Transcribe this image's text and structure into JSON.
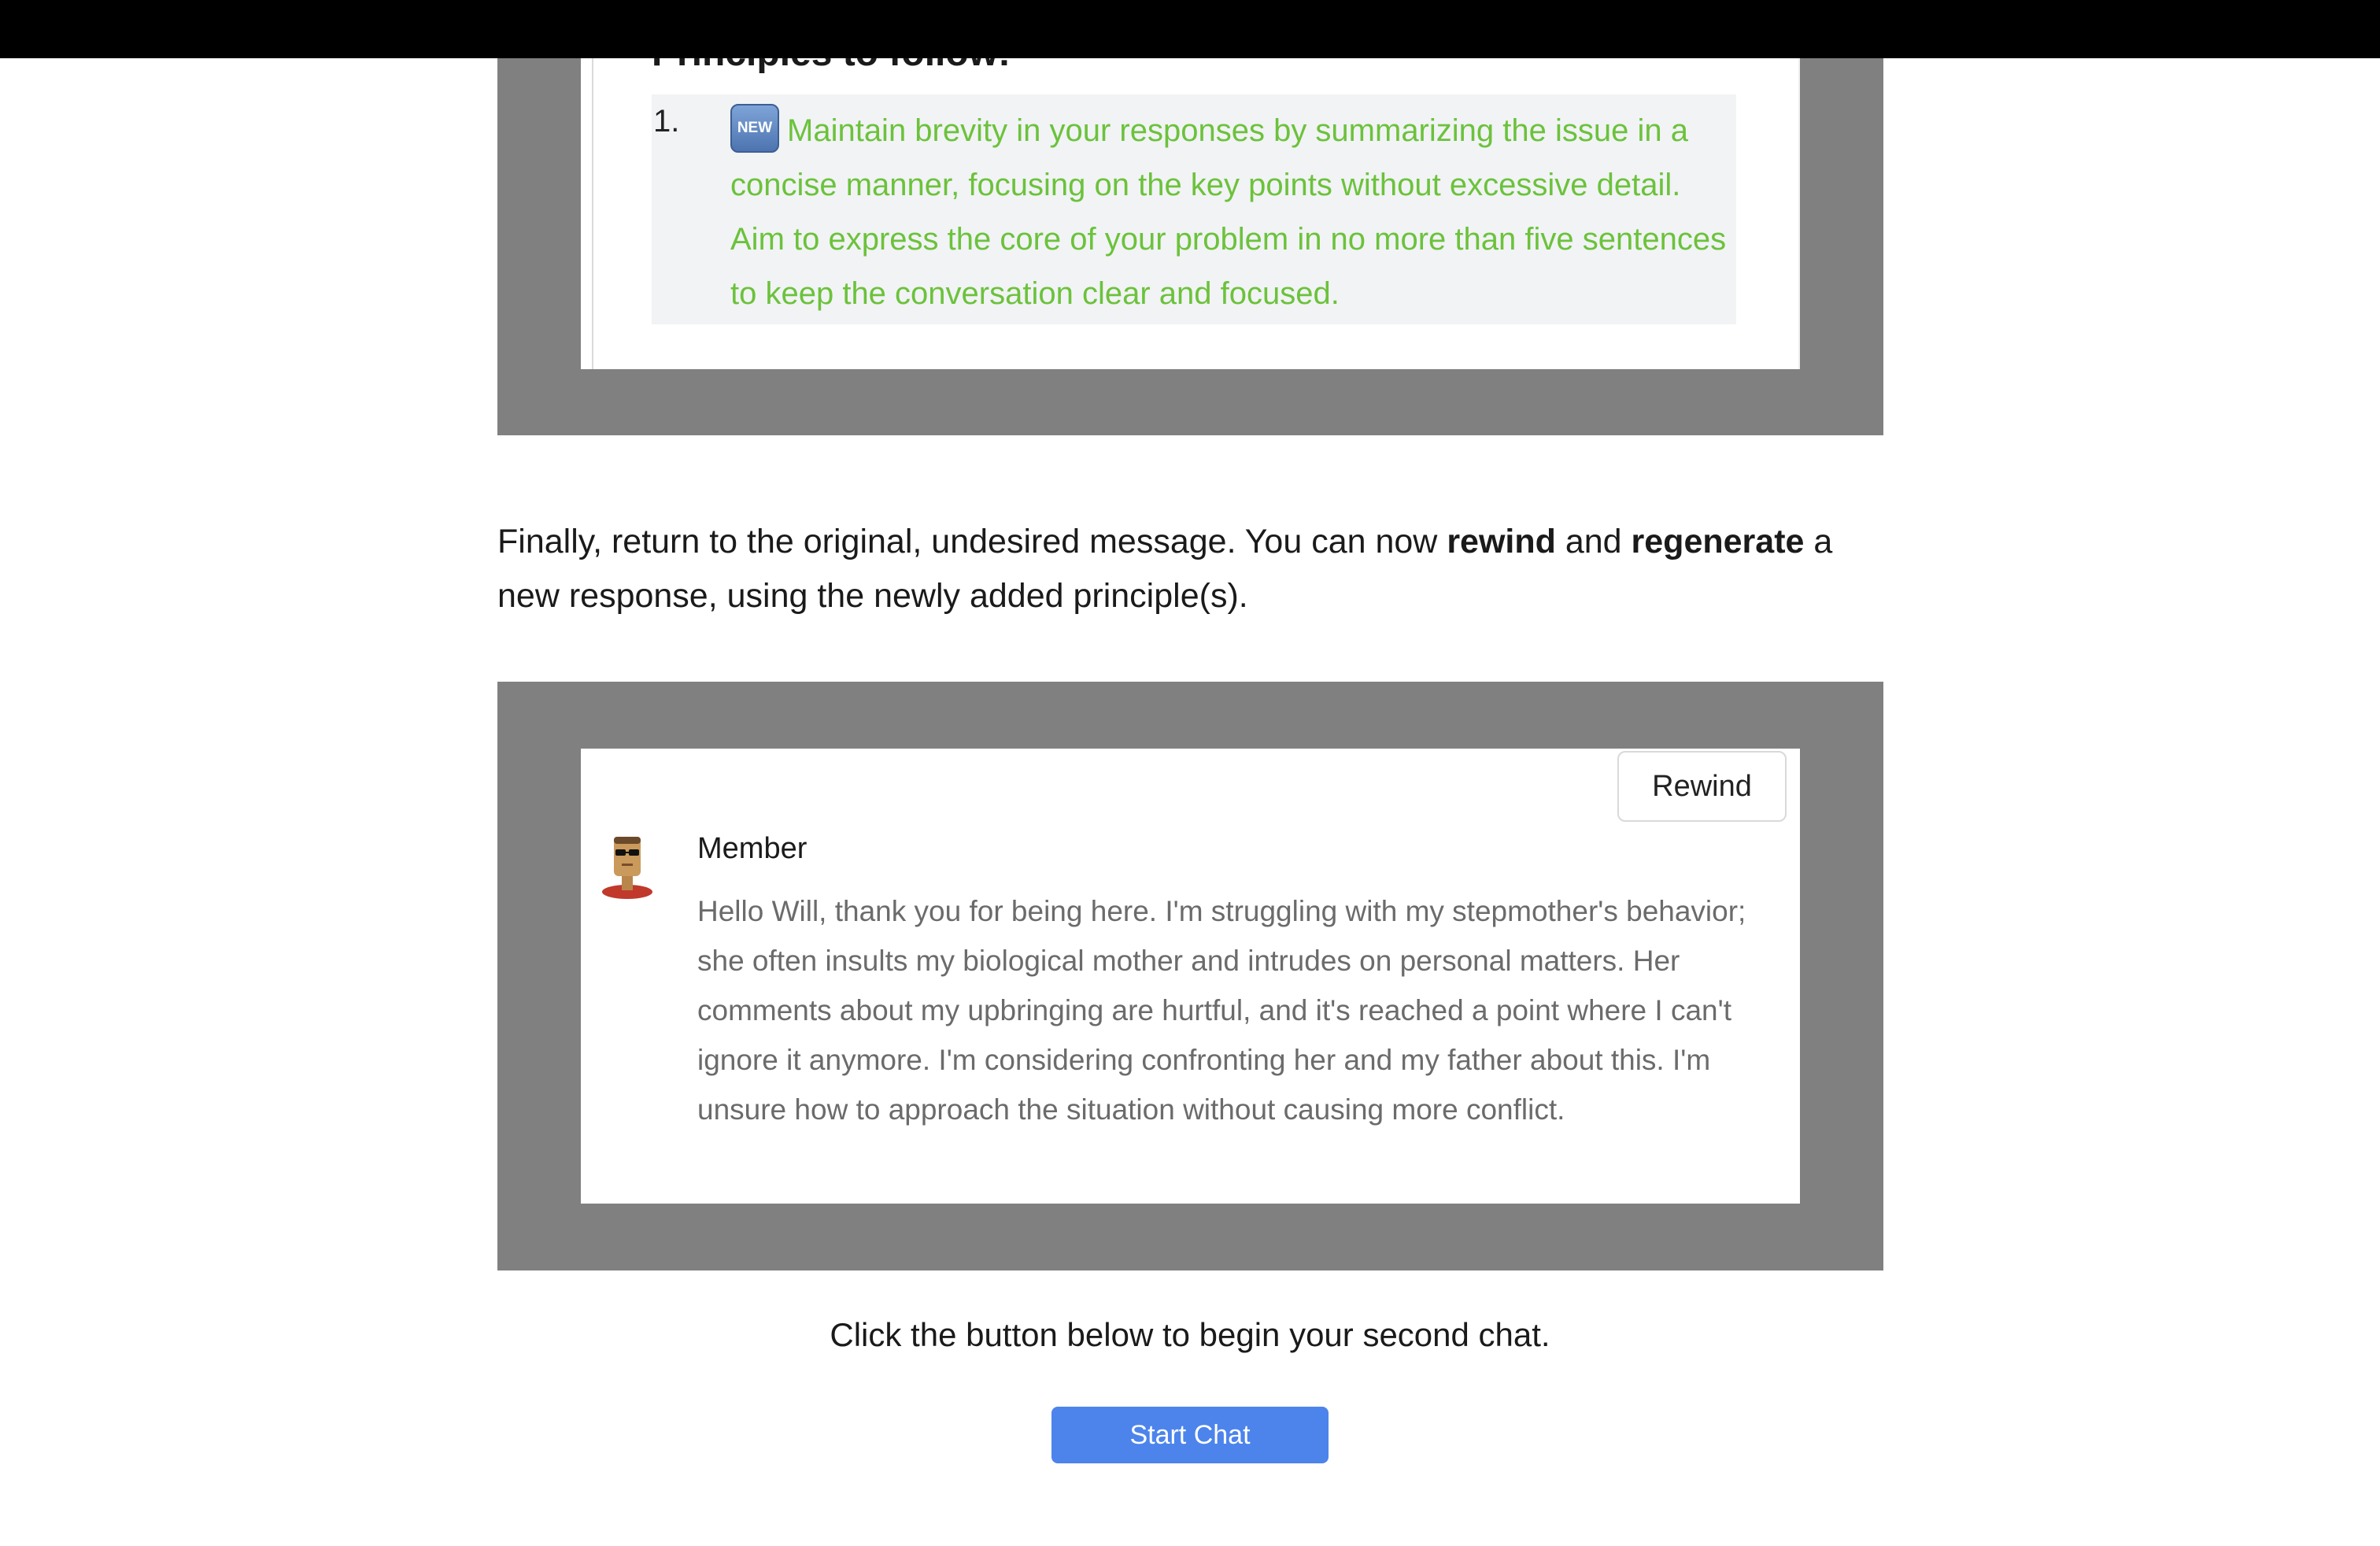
{
  "principles": {
    "heading": "Principles to follow:",
    "items": [
      {
        "number": "1.",
        "badge": "NEW",
        "text": "Maintain brevity in your responses by summarizing the issue in a concise manner, focusing on the key points without excessive detail. Aim to express the core of your problem in no more than five sentences to keep the conversation clear and focused."
      }
    ]
  },
  "instruction": {
    "part1": "Finally, return to the original, undesired message. You can now ",
    "bold1": "rewind",
    "part2": " and ",
    "bold2": "regenerate",
    "part3": " a new response, using the newly added principle(s)."
  },
  "message_card": {
    "rewind_label": "Rewind",
    "member_name": "Member",
    "member_text": "Hello Will, thank you for being here. I'm struggling with my stepmother's behavior; she often insults my biological mother and intrudes on personal matters. Her comments about my upbringing are hurtful, and it's reached a point where I can't ignore it anymore. I'm considering confronting her and my father about this. I'm unsure how to approach the situation without causing more conflict."
  },
  "footer": {
    "click_text": "Click the button below to begin your second chat.",
    "start_label": "Start Chat"
  },
  "colors": {
    "frame_gray": "#808080",
    "principle_green": "#6cc23b",
    "button_blue": "#4c84ec"
  }
}
